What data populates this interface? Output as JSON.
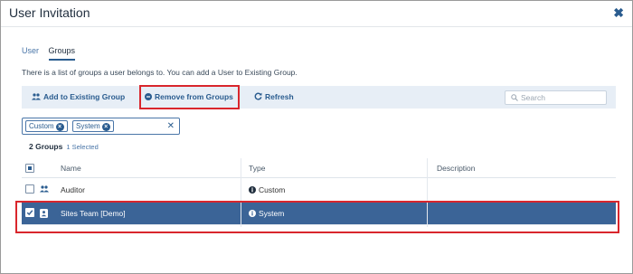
{
  "dialog": {
    "title": "User Invitation"
  },
  "tabs": [
    {
      "label": "User",
      "active": false
    },
    {
      "label": "Groups",
      "active": true
    }
  ],
  "description": "There is a list of groups a user belongs to. You can add a User to Existing Group.",
  "toolbar": {
    "add_label": "Add to Existing Group",
    "remove_label": "Remove from Groups",
    "refresh_label": "Refresh",
    "search_placeholder": "Search"
  },
  "filters": {
    "chips": [
      "Custom",
      "System"
    ]
  },
  "summary": {
    "count": "2 Groups",
    "selected": "1 Selected"
  },
  "table": {
    "columns": [
      "Name",
      "Type",
      "Description"
    ],
    "rows": [
      {
        "name": "Auditor",
        "type": "Custom",
        "description": "",
        "selected": false,
        "icon": "group-icon"
      },
      {
        "name": "Sites Team [Demo]",
        "type": "System",
        "description": "",
        "selected": true,
        "icon": "user-badge-icon"
      }
    ]
  },
  "colors": {
    "accent": "#2a5c8f",
    "selected_row": "#3b6497",
    "toolbar_bg": "#e7eef6",
    "highlight": "#d9262c"
  }
}
